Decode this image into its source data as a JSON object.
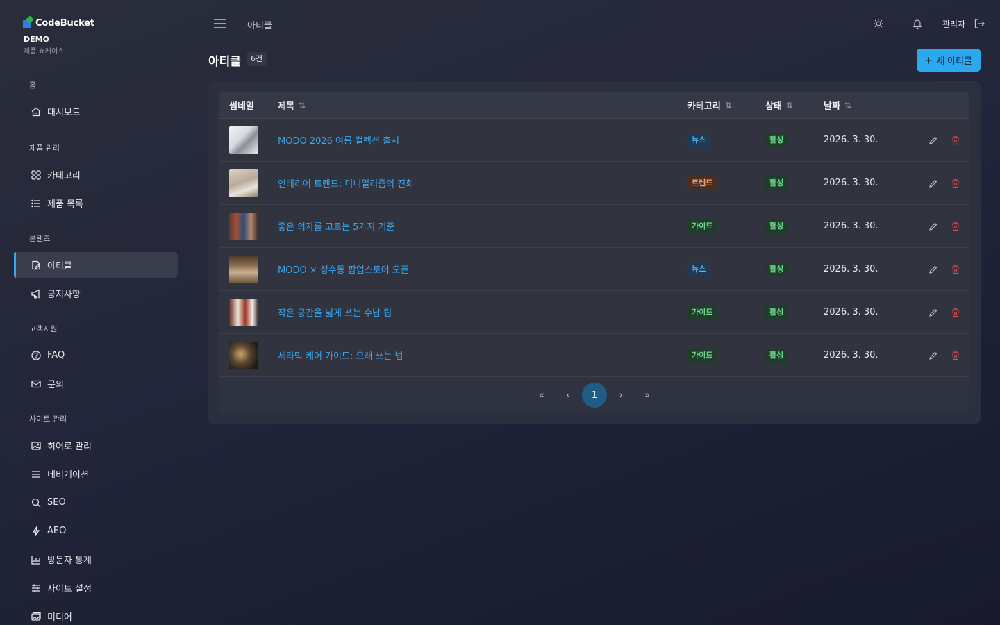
{
  "brand": {
    "logo_text": "CodeBucket",
    "demo": "DEMO",
    "sub": "제품 쇼케이스"
  },
  "sidebar": {
    "sections": [
      {
        "title": "홈",
        "items": [
          {
            "label": "대시보드",
            "icon": "home-icon"
          }
        ]
      },
      {
        "title": "제품 관리",
        "items": [
          {
            "label": "카테고리",
            "icon": "grid-icon"
          },
          {
            "label": "제품 목록",
            "icon": "list-icon"
          }
        ]
      },
      {
        "title": "콘텐츠",
        "items": [
          {
            "label": "아티클",
            "icon": "article-icon",
            "active": true
          },
          {
            "label": "공지사항",
            "icon": "megaphone-icon"
          }
        ]
      },
      {
        "title": "고객지원",
        "items": [
          {
            "label": "FAQ",
            "icon": "help-circle-icon"
          },
          {
            "label": "문의",
            "icon": "mail-icon"
          }
        ]
      },
      {
        "title": "사이트 관리",
        "items": [
          {
            "label": "히어로 관리",
            "icon": "image-icon"
          },
          {
            "label": "네비게이션",
            "icon": "menu-icon"
          },
          {
            "label": "SEO",
            "icon": "search-icon"
          },
          {
            "label": "AEO",
            "icon": "lightning-icon"
          },
          {
            "label": "방문자 통계",
            "icon": "bar-chart-icon"
          },
          {
            "label": "사이트 설정",
            "icon": "sliders-icon"
          },
          {
            "label": "미디어",
            "icon": "media-icon"
          }
        ]
      }
    ]
  },
  "topbar": {
    "breadcrumb": "아티클",
    "admin_label": "관리자"
  },
  "page": {
    "title": "아티클",
    "count": "6건",
    "new_button": "새 아티클"
  },
  "table": {
    "headers": {
      "thumbnail": "썸네일",
      "title": "제목",
      "category": "카테고리",
      "status": "상태",
      "date": "날짜"
    },
    "rows": [
      {
        "title": "MODO 2026 여름 컬렉션 출시",
        "category": "뉴스",
        "status": "활성",
        "date": "2026. 3. 30."
      },
      {
        "title": "인테리어 트렌드: 미니멀리즘의 진화",
        "category": "트렌드",
        "status": "활성",
        "date": "2026. 3. 30."
      },
      {
        "title": "좋은 의자를 고르는 5가지 기준",
        "category": "가이드",
        "status": "활성",
        "date": "2026. 3. 30."
      },
      {
        "title": "MODO × 성수동 팝업스토어 오픈",
        "category": "뉴스",
        "status": "활성",
        "date": "2026. 3. 30."
      },
      {
        "title": "작은 공간을 넓게 쓰는 수납 팁",
        "category": "가이드",
        "status": "활성",
        "date": "2026. 3. 30."
      },
      {
        "title": "세라믹 케어 가이드: 오래 쓰는 법",
        "category": "가이드",
        "status": "활성",
        "date": "2026. 3. 30."
      }
    ]
  },
  "pagination": {
    "current": "1"
  },
  "colors": {
    "accent": "#2ba8ee",
    "link": "#3aa6f0",
    "chip_news_bg": "#1e3a55",
    "chip_news_fg": "#5cb6f2",
    "chip_trend_bg": "#4a2e22",
    "chip_trend_fg": "#f0a27a",
    "chip_guide_bg": "#1f3d2a",
    "chip_guide_fg": "#6fd48e",
    "chip_active_bg": "#1f3d2a",
    "chip_active_fg": "#6fd48e",
    "delete": "#e5484d"
  }
}
